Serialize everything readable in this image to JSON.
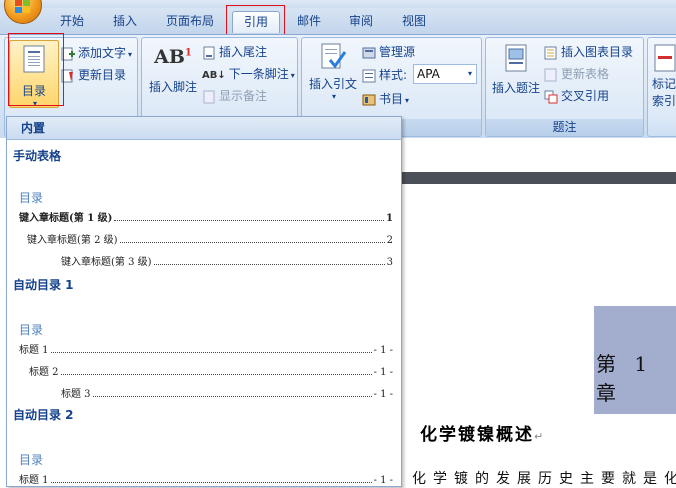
{
  "tabs": [
    {
      "label": "开始"
    },
    {
      "label": "插入"
    },
    {
      "label": "页面布局"
    },
    {
      "label": "引用"
    },
    {
      "label": "邮件"
    },
    {
      "label": "审阅"
    },
    {
      "label": "视图"
    }
  ],
  "active_tab": "引用",
  "ribbon": {
    "toc_group": {
      "toc_button": "目录",
      "add_text": "添加文字",
      "update_toc": "更新目录"
    },
    "footnote_group": {
      "insert_footnote": "插入脚注",
      "insert_endnote": "插入尾注",
      "next_footnote": "下一条脚注",
      "show_notes": "显示备注",
      "ab_glyph": "AB"
    },
    "citation_group": {
      "insert_citation": "插入引文",
      "manage_sources": "管理源",
      "style_label": "样式:",
      "style_value": "APA",
      "bibliography": "书目",
      "group_label_partial": "书目"
    },
    "caption_group": {
      "insert_caption": "插入题注",
      "insert_table_of_figures": "插入图表目录",
      "update_table": "更新表格",
      "cross_reference": "交叉引用",
      "label": "题注"
    },
    "index_group": {
      "mark_entry_line1": "标记",
      "mark_entry_line2": "索引项"
    }
  },
  "toc_gallery": {
    "header": "内置",
    "manual": {
      "title": "手动表格",
      "heading": "目录",
      "lines": [
        {
          "text": "键入章标题(第 1 级)",
          "page": "1"
        },
        {
          "text": "键入章标题(第 2 级)",
          "page": "2"
        },
        {
          "text": "键入章标题(第 3 级)",
          "page": "3"
        }
      ]
    },
    "auto1": {
      "title": "自动目录 1",
      "heading": "目录",
      "lines": [
        {
          "text": "标题 1",
          "page": "- 1 -"
        },
        {
          "text": "标题 2",
          "page": "- 1 -"
        },
        {
          "text": "标题 3",
          "page": "- 1 -"
        }
      ]
    },
    "auto2": {
      "title": "自动目录 2",
      "heading": "目录",
      "lines": [
        {
          "text": "标题 1",
          "page": "- 1 -"
        }
      ]
    }
  },
  "document": {
    "chapter": "第 1 章",
    "heading": "化学镀镍概述",
    "paragraph_mark": "↵",
    "body_start": "化学镀的发展历史主要就是化"
  },
  "colors": {
    "highlight_box": "#e0101a",
    "ribbon_text": "#15428b",
    "toc_heading": "#4f81bd",
    "chapter_block": "#a3aecf"
  }
}
